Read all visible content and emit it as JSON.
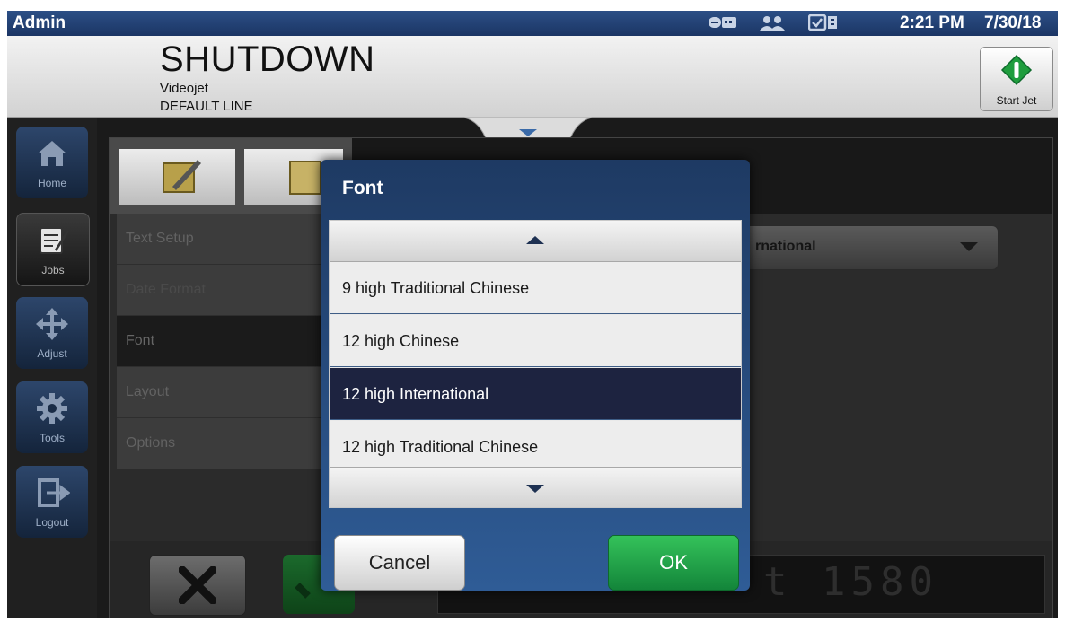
{
  "status_bar": {
    "user": "Admin",
    "time": "2:21 PM",
    "date": "7/30/18",
    "icons": [
      "network-icon",
      "users-icon",
      "checklist-icon"
    ]
  },
  "header": {
    "state": "SHUTDOWN",
    "printer_name": "Videojet",
    "line_name": "DEFAULT LINE",
    "start_jet_label": "Start Jet"
  },
  "sidebar": {
    "items": [
      {
        "label": "Home",
        "icon": "home-icon"
      },
      {
        "label": "Jobs",
        "icon": "jobs-icon"
      },
      {
        "label": "Adjust",
        "icon": "move-icon"
      },
      {
        "label": "Tools",
        "icon": "gear-icon"
      },
      {
        "label": "Logout",
        "icon": "logout-icon"
      }
    ]
  },
  "text_setup": {
    "menu": [
      "Text Setup",
      "Date Format",
      "Font",
      "Layout",
      "Options"
    ],
    "current_font_fragment": "rnational"
  },
  "preview": {
    "text": "t 1580"
  },
  "dialog": {
    "title": "Font",
    "items": [
      "9 high Traditional Chinese",
      "12 high Chinese",
      "12 high International",
      "12 high Traditional Chinese"
    ],
    "selected": "12 high International",
    "cancel_label": "Cancel",
    "ok_label": "OK"
  },
  "colors": {
    "status_bar": "#1b3564",
    "dialog": "#2f5c96",
    "selected_row": "#1d2340",
    "ok_button": "#13853a",
    "start_jet": "#1f9d3d"
  }
}
